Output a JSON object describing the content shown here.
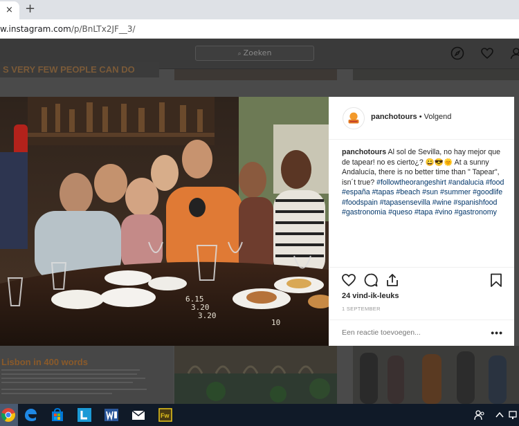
{
  "browser": {
    "tab_close": "×",
    "new_tab": "+",
    "url_host": "w.instagram.com",
    "url_path": "/p/BnLTx2JF__3/"
  },
  "header": {
    "search_placeholder": "Zoeken",
    "search_icon_glyph": "🔍"
  },
  "background": {
    "top_strip_text": "S VERY FEW PEOPLE CAN DO",
    "bottom_left_title": "Lisbon in 400 words"
  },
  "post": {
    "username": "panchotours",
    "follow_label": "• Volgend",
    "caption_user": "panchotours",
    "caption_text": "Al sol de Sevilla, no hay mejor que de tapear! no es cierto¿? 😀😎🌞 At a sunny Andalucía, there is no better time than \" Tapear\", isn´t true?",
    "hashtags": [
      "#followtheorangeshirt",
      "#andalucia",
      "#food",
      "#españa",
      "#tapas",
      "#beach",
      "#sun",
      "#summer",
      "#goodlife",
      "#foodspain",
      "#tapasensevilla",
      "#wine",
      "#spanishfood",
      "#gastronomia",
      "#queso",
      "#tapa",
      "#vino",
      "#gastronomy"
    ],
    "likes": "24 vind-ik-leuks",
    "date": "1 SEPTEMBER",
    "comment_placeholder": "Een reactie toevoegen...",
    "more": "•••"
  },
  "photo": {
    "chalk_text": [
      "6.15",
      "3.20",
      "3.20"
    ],
    "bottom_chalk": "10"
  },
  "colors": {
    "hashtag": "#003569",
    "overlay": "#3a3a3a",
    "taskbar": "#101a28"
  }
}
